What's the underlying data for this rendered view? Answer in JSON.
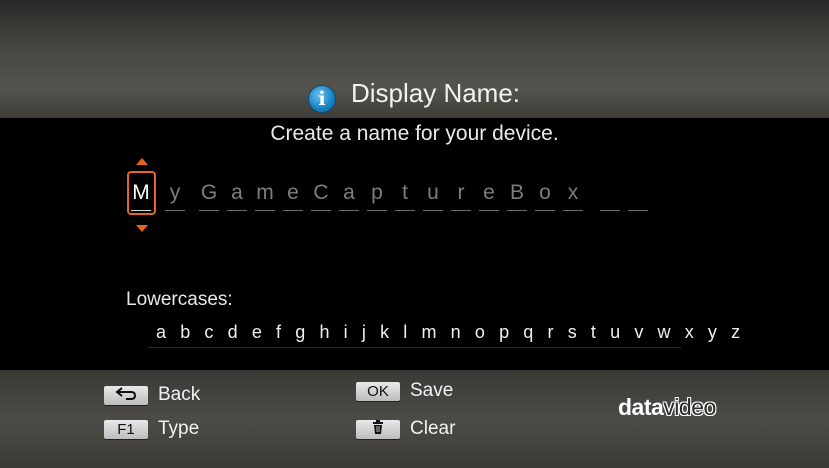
{
  "header": {
    "title": "Display Name:",
    "icon": "info-icon"
  },
  "subtitle": "Create a name for your device.",
  "name_editor": {
    "characters": [
      "M",
      "y",
      "G",
      "a",
      "m",
      "e",
      "C",
      "a",
      "p",
      "t",
      "u",
      "r",
      "e",
      "B",
      "o",
      "x",
      "",
      ""
    ],
    "cursor_index": 0,
    "accent_color": "#e8641e"
  },
  "character_set": {
    "label": "Lowercases:",
    "letters": "a b c d e f g h i j k l m n o p q r s t u v w x y z"
  },
  "footer": {
    "back": {
      "key_icon": "return-arrow-icon",
      "label": "Back"
    },
    "type": {
      "key": "F1",
      "label": "Type"
    },
    "save": {
      "key": "OK",
      "label": "Save"
    },
    "clear": {
      "key_icon": "trash-icon",
      "label": "Clear"
    }
  },
  "brand": {
    "logo_bold": "data",
    "logo_thin": "video"
  }
}
